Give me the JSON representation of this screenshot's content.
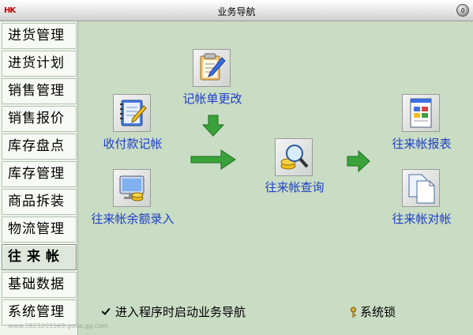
{
  "window": {
    "logo": "HK",
    "title": "业务导航"
  },
  "sidebar": {
    "items": [
      {
        "label": "进货管理"
      },
      {
        "label": "进货计划"
      },
      {
        "label": "销售管理"
      },
      {
        "label": "销售报价"
      },
      {
        "label": "库存盘点"
      },
      {
        "label": "库存管理"
      },
      {
        "label": "商品拆装"
      },
      {
        "label": "物流管理"
      },
      {
        "label": "往来帐",
        "active": true
      },
      {
        "label": "基础数据"
      },
      {
        "label": "系统管理"
      }
    ]
  },
  "nodes": {
    "receipt_payment": {
      "label": "收付款记帐",
      "icon": "notebook-pencil-icon"
    },
    "initial_balance": {
      "label": "往来帐余额录入",
      "icon": "monitor-coins-icon"
    },
    "voucher_edit": {
      "label": "记帐单更改",
      "icon": "clipboard-pencil-icon"
    },
    "account_query": {
      "label": "往来帐查询",
      "icon": "magnifier-coins-icon"
    },
    "account_report": {
      "label": "往来帐报表",
      "icon": "report-document-icon"
    },
    "account_reconcile": {
      "label": "往来帐对帐",
      "icon": "copy-documents-icon"
    }
  },
  "footer": {
    "startup_checkbox": {
      "label": "进入程序时启动业务导航",
      "checked": true
    },
    "system_lock": {
      "label": "系统锁",
      "icon": "lock-key-icon"
    }
  },
  "watermark": "www.5825205569.gooa.gg.com"
}
